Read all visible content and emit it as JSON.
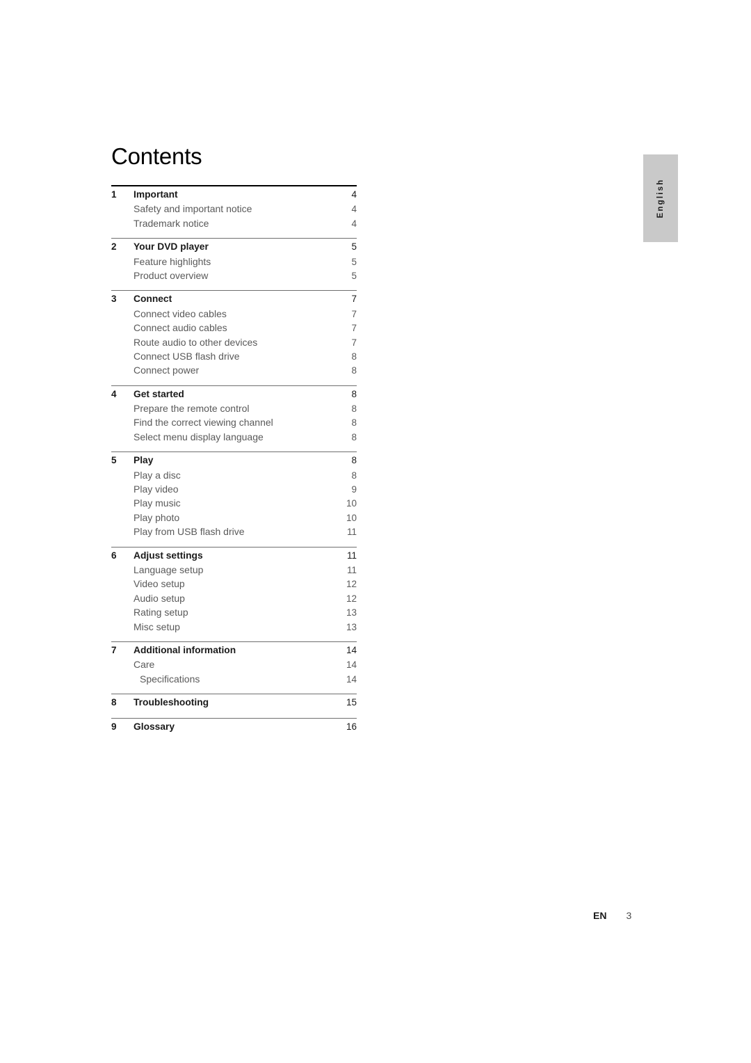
{
  "language_tab": {
    "label": "English"
  },
  "page_title": "Contents",
  "toc": {
    "groups": [
      {
        "number": "1",
        "heading": "Important",
        "heading_page": "4",
        "items": [
          {
            "label": "Safety and important notice",
            "page": "4",
            "indent": false
          },
          {
            "label": "Trademark notice",
            "page": "4",
            "indent": false
          }
        ]
      },
      {
        "number": "2",
        "heading": "Your DVD player",
        "heading_page": "5",
        "items": [
          {
            "label": "Feature highlights",
            "page": "5",
            "indent": false
          },
          {
            "label": "Product overview",
            "page": "5",
            "indent": false
          }
        ]
      },
      {
        "number": "3",
        "heading": "Connect",
        "heading_page": "7",
        "items": [
          {
            "label": "Connect video cables",
            "page": "7",
            "indent": false
          },
          {
            "label": "Connect audio cables",
            "page": "7",
            "indent": false
          },
          {
            "label": "Route audio to other devices",
            "page": "7",
            "indent": false
          },
          {
            "label": "Connect USB flash drive",
            "page": "8",
            "indent": false
          },
          {
            "label": "Connect power",
            "page": "8",
            "indent": false
          }
        ]
      },
      {
        "number": "4",
        "heading": "Get started",
        "heading_page": "8",
        "items": [
          {
            "label": "Prepare the remote control",
            "page": "8",
            "indent": false
          },
          {
            "label": "Find the correct viewing channel",
            "page": "8",
            "indent": false
          },
          {
            "label": "Select menu display language",
            "page": "8",
            "indent": false
          }
        ]
      },
      {
        "number": "5",
        "heading": "Play",
        "heading_page": "8",
        "items": [
          {
            "label": "Play a disc",
            "page": "8",
            "indent": false
          },
          {
            "label": "Play video",
            "page": "9",
            "indent": false
          },
          {
            "label": "Play music",
            "page": "10",
            "indent": false
          },
          {
            "label": "Play photo",
            "page": "10",
            "indent": false
          },
          {
            "label": "Play from USB flash drive",
            "page": "11",
            "indent": false
          }
        ]
      },
      {
        "number": "6",
        "heading": "Adjust settings",
        "heading_page": "11",
        "items": [
          {
            "label": "Language setup",
            "page": "11",
            "indent": false
          },
          {
            "label": "Video setup",
            "page": "12",
            "indent": false
          },
          {
            "label": "Audio setup",
            "page": "12",
            "indent": false
          },
          {
            "label": "Rating setup",
            "page": "13",
            "indent": false
          },
          {
            "label": "Misc setup",
            "page": "13",
            "indent": false
          }
        ]
      },
      {
        "number": "7",
        "heading": "Additional information",
        "heading_page": "14",
        "items": [
          {
            "label": "Care",
            "page": "14",
            "indent": false
          },
          {
            "label": "Specifications",
            "page": "14",
            "indent": true
          }
        ]
      },
      {
        "number": "8",
        "heading": "Troubleshooting",
        "heading_page": "15",
        "items": []
      },
      {
        "number": "9",
        "heading": "Glossary",
        "heading_page": "16",
        "items": []
      }
    ]
  },
  "footer": {
    "language_code": "EN",
    "page_number": "3"
  }
}
